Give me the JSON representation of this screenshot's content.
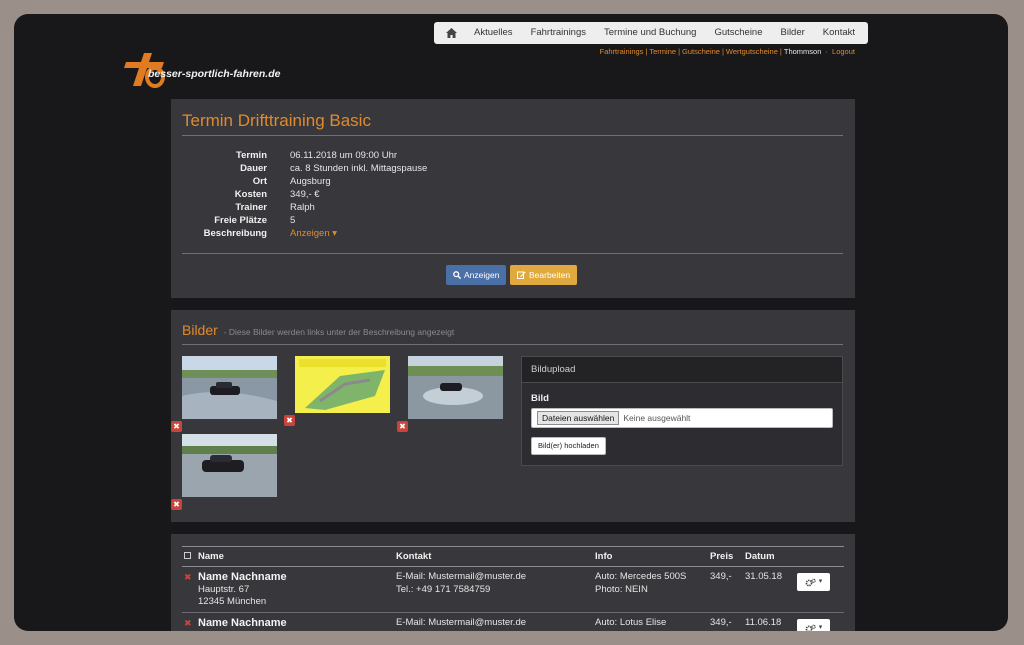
{
  "nav": {
    "home_icon": "home-icon",
    "items": [
      "Aktuelles",
      "Fahrtrainings",
      "Termine und Buchung",
      "Gutscheine",
      "Bilder",
      "Kontakt"
    ]
  },
  "subnav": {
    "links": [
      "Fahrtrainings",
      "Termine",
      "Gutscheine",
      "Wertgutscheine"
    ],
    "user": "Thommson",
    "logout": "Logout"
  },
  "brand": {
    "name": "besser-sportlich-fahren.de",
    "accent": "#e08a2c"
  },
  "termin": {
    "title": "Termin Drifttraining Basic",
    "rows": [
      {
        "label": "Termin",
        "value": "06.11.2018 um 09:00 Uhr"
      },
      {
        "label": "Dauer",
        "value": "ca. 8 Stunden inkl. Mittagspause"
      },
      {
        "label": "Ort",
        "value": "Augsburg"
      },
      {
        "label": "Kosten",
        "value": "349,- €"
      },
      {
        "label": "Trainer",
        "value": "Ralph"
      },
      {
        "label": "Freie Plätze",
        "value": "5"
      },
      {
        "label": "Beschreibung",
        "value": "Anzeigen"
      }
    ],
    "btn_show": "Anzeigen",
    "btn_edit": "Bearbeiten"
  },
  "bilder": {
    "title": "Bilder",
    "subtitle": "- Diese Bilder werden links unter der Beschreibung angezeigt",
    "upload": {
      "header": "Bildupload",
      "label": "Bild",
      "file_button": "Dateien auswählen",
      "file_status": "Keine ausgewählt",
      "submit": "Bild(er) hochladen"
    }
  },
  "participants": {
    "columns": [
      "Name",
      "Kontakt",
      "Info",
      "Preis",
      "Datum"
    ],
    "rows": [
      {
        "name": "Name Nachname",
        "street": "Hauptstr. 67",
        "city": "12345 München",
        "email": "E-Mail: Mustermail@muster.de",
        "phone": "Tel.: +49 171 7584759",
        "auto": "Auto: Mercedes 500S",
        "photo": "Photo: NEIN",
        "price": "349,-",
        "date": "31.05.18"
      },
      {
        "name": "Name Nachname",
        "street": "",
        "city": "",
        "email": "E-Mail: Mustermail@muster.de",
        "phone": "",
        "auto": "Auto: Lotus Elise",
        "photo": "",
        "price": "349,-",
        "date": "11.06.18"
      }
    ]
  }
}
